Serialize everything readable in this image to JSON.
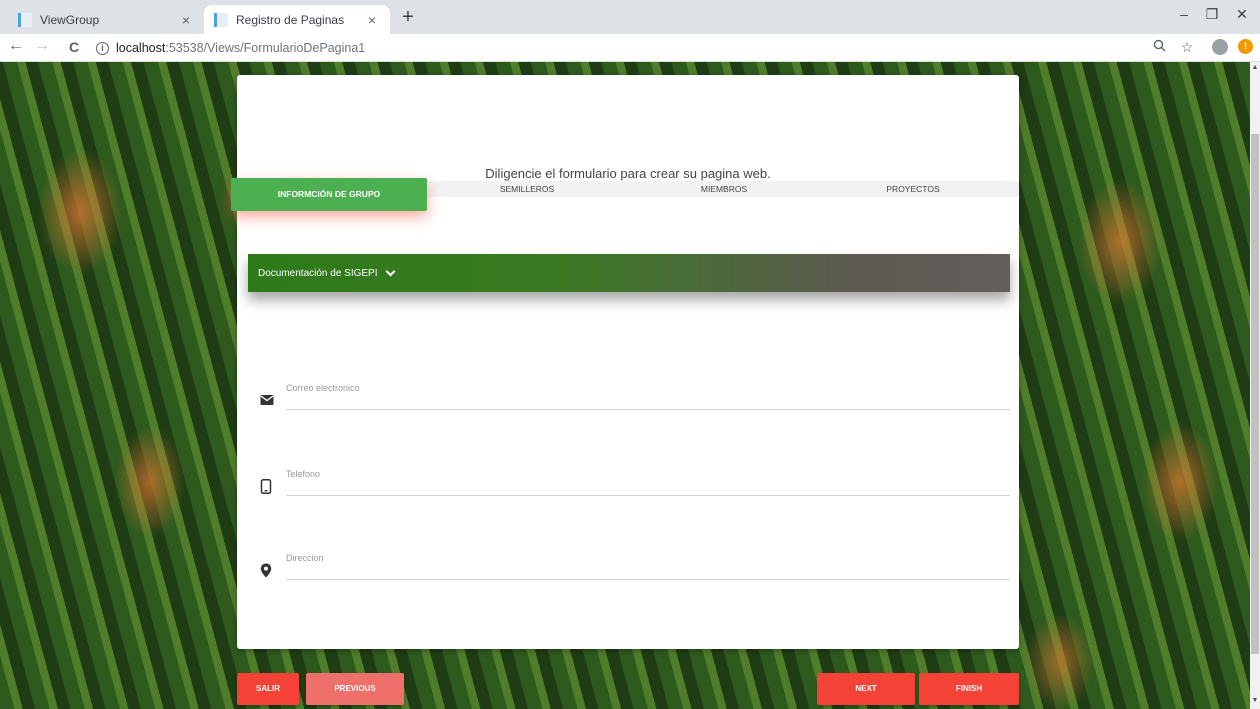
{
  "browser": {
    "tabs": [
      {
        "title": "ViewGroup",
        "close": "×"
      },
      {
        "title": "Registro de Paginas",
        "close": "×"
      }
    ],
    "new_tab": "+",
    "window_controls": {
      "minimize": "–",
      "restore": "❐",
      "close": "✕"
    },
    "nav": {
      "back": "←",
      "forward": "→",
      "reload": "C"
    },
    "url": {
      "info": "i",
      "host": "localhost",
      "path": ":53538/Views/FormularioDePagina1"
    },
    "toolbar_icons": {
      "zoom": "zoom-icon",
      "bookmark": "☆"
    },
    "extension_badge": "!"
  },
  "form": {
    "instructions": "Diligencie el formulario para crear su pagina web.",
    "wizard_tabs": [
      {
        "label": "INFORMCIÓN DE GRUPO",
        "active": true
      },
      {
        "label": "SEMILLEROS",
        "active": false
      },
      {
        "label": "MIEMBROS",
        "active": false
      },
      {
        "label": "PROYECTOS",
        "active": false
      }
    ],
    "accordion": {
      "label": "Documentación de SIGEPI"
    },
    "fields": [
      {
        "placeholder": "Correo electronico",
        "icon": "mail-icon"
      },
      {
        "placeholder": "Telefono",
        "icon": "phone-icon"
      },
      {
        "placeholder": "Direccion",
        "icon": "location-pin-icon"
      }
    ]
  },
  "buttons": {
    "exit": "SALIR",
    "previous": "PREVIOUS",
    "next": "NEXT",
    "finish": "FINISH"
  },
  "colors": {
    "active_tab": "#4caf50",
    "accordion_start": "#2d7a1a",
    "accordion_end": "#625e5c",
    "button_red": "#f44336",
    "button_previous": "#ef6f6a"
  }
}
